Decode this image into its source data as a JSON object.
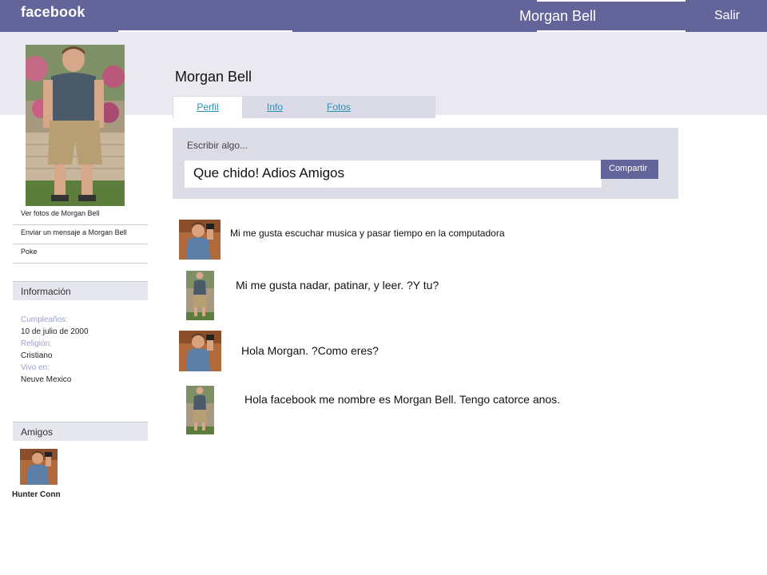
{
  "topbar": {
    "logo": "facebook",
    "user_name": "Morgan Bell",
    "logout_label": "Salir",
    "color": "#63649a"
  },
  "profile": {
    "name": "Morgan Bell"
  },
  "tabs": [
    {
      "label": "Perfil",
      "active": true
    },
    {
      "label": "Info",
      "active": false
    },
    {
      "label": "Fotos",
      "active": false
    },
    {
      "label": "",
      "active": false
    }
  ],
  "sidebar": {
    "links": [
      {
        "label": "Ver fotos de Morgan Bell"
      },
      {
        "label": "Enviar un mensaje a Morgan Bell"
      },
      {
        "label": "Poke"
      }
    ],
    "info_heading": "Información",
    "info": [
      {
        "label": "Cumpleaños:",
        "value": "10 de julio de 2000"
      },
      {
        "label": "Religión:",
        "value": "Cristiano"
      },
      {
        "label": "Vivo en:",
        "value": "Neuve Mexico"
      }
    ],
    "friends_heading": "Amigos",
    "friends": [
      {
        "name": "Hunter Conn"
      }
    ]
  },
  "composer": {
    "label": "Escribir algo...",
    "value": "Que chido! Adios Amigos",
    "share_label": "Compartir"
  },
  "posts": [
    {
      "text": "Mi me gusta escuchar musica y pasar tiempo en la computadora",
      "author_photo": "mirror-selfie"
    },
    {
      "text": "Mi me gusta nadar, patinar, y leer. ?Y tu?",
      "author_photo": "standing-boy"
    },
    {
      "text": "Hola Morgan. ?Como eres?",
      "author_photo": "mirror-selfie"
    },
    {
      "text": "Hola facebook me nombre es Morgan Bell. Tengo catorce anos.",
      "author_photo": "standing-boy"
    }
  ]
}
